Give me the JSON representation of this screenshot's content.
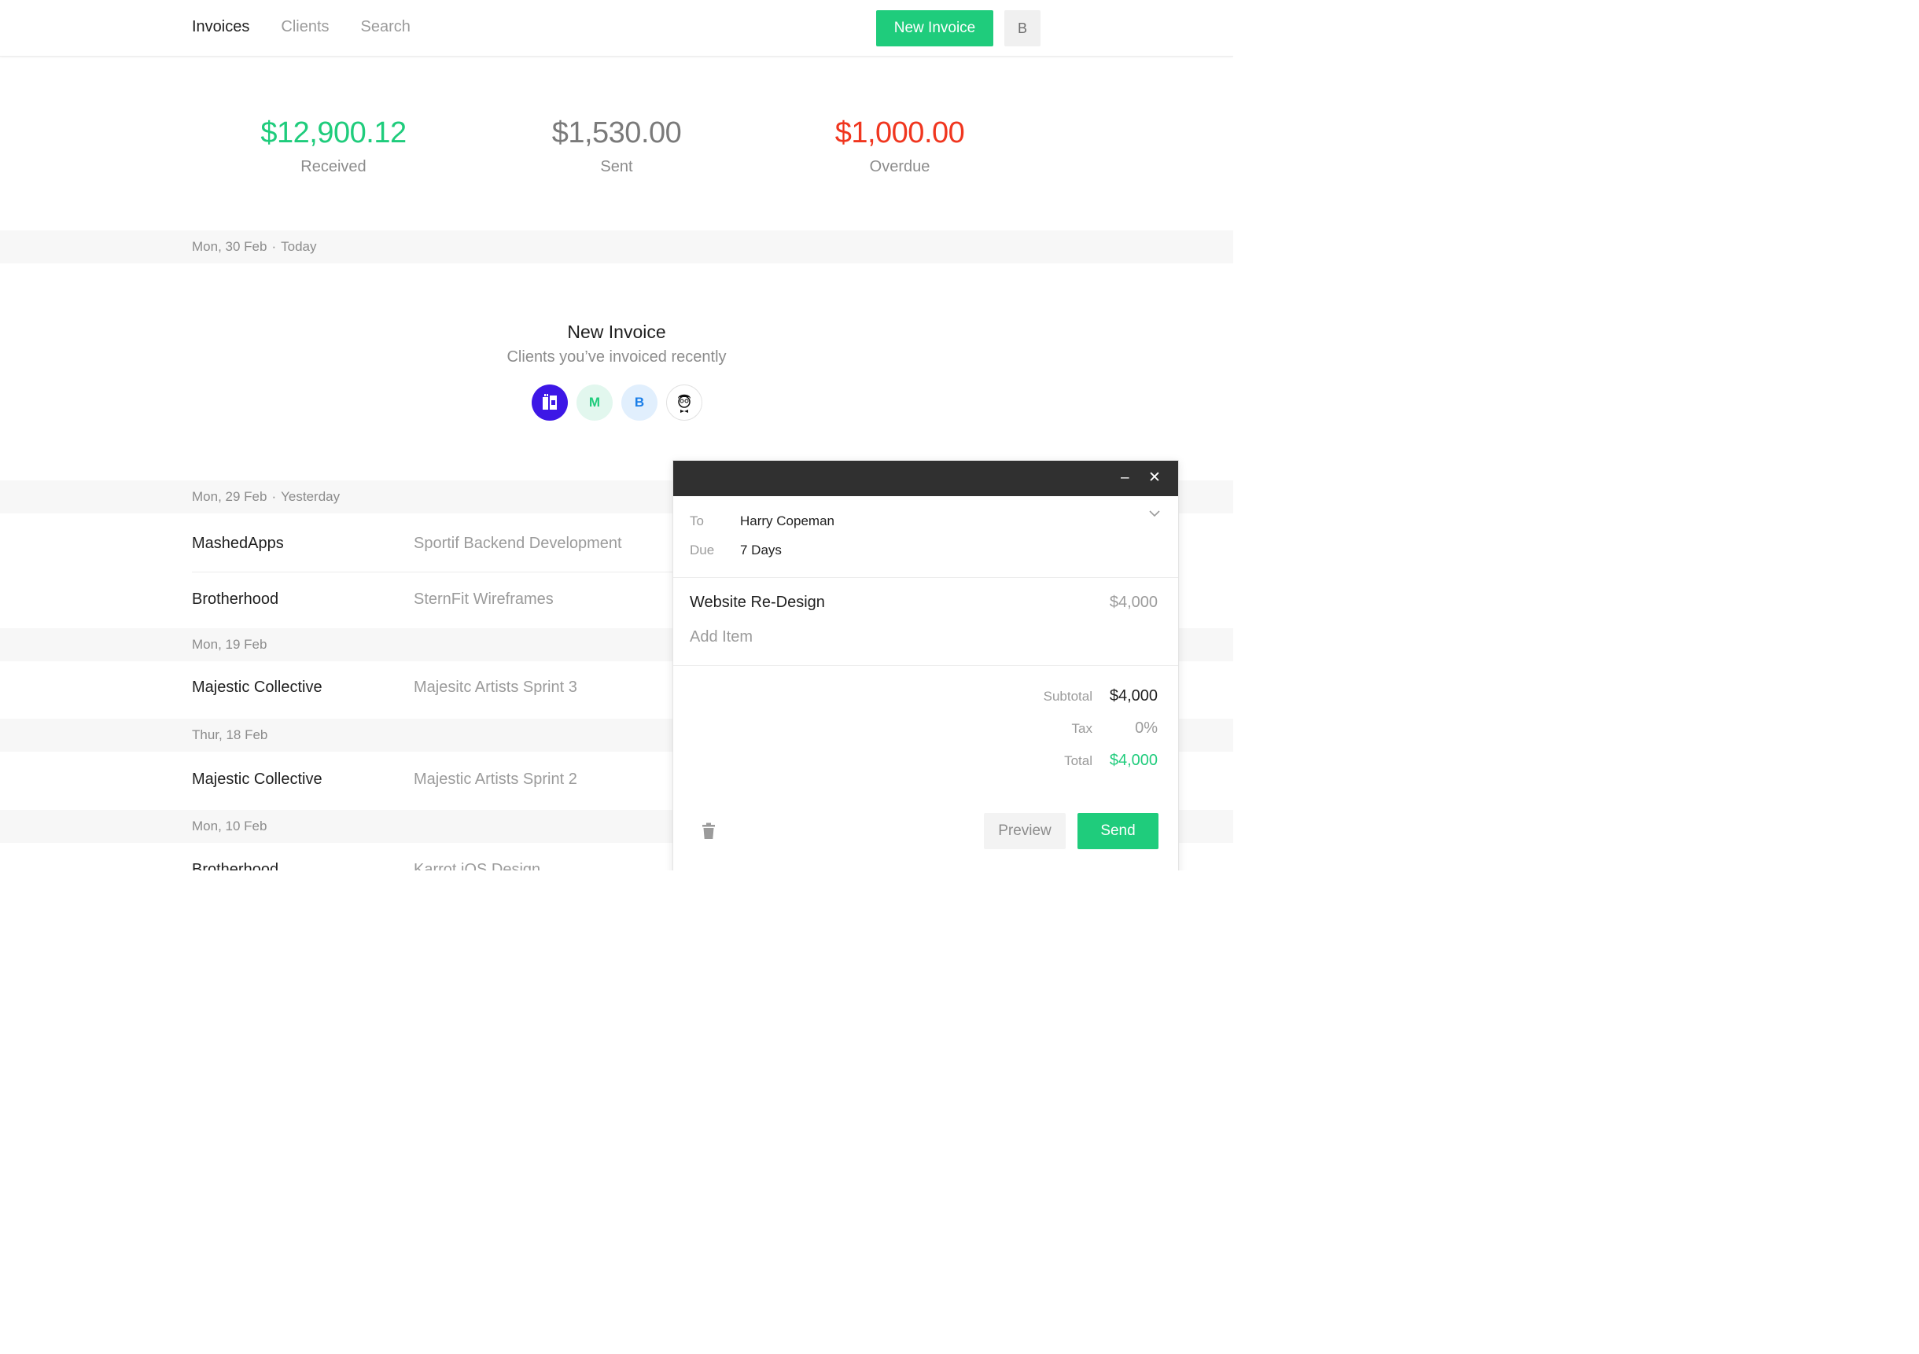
{
  "nav": {
    "items": [
      {
        "label": "Invoices",
        "active": true
      },
      {
        "label": "Clients",
        "active": false
      },
      {
        "label": "Search",
        "active": false
      }
    ],
    "new_invoice_label": "New Invoice",
    "user_initial": "B"
  },
  "stats": {
    "received": {
      "amount": "$12,900.12",
      "label": "Received",
      "color": "#1fcc7c"
    },
    "sent": {
      "amount": "$1,530.00",
      "label": "Sent",
      "color": "#7a7a7a"
    },
    "overdue": {
      "amount": "$1,000.00",
      "label": "Overdue",
      "color": "#f0361f"
    }
  },
  "today": {
    "date": "Mon, 30 Feb",
    "relative": "Today"
  },
  "new_invoice": {
    "title": "New Invoice",
    "subtitle": "Clients you’ve invoiced recently",
    "recent_clients": [
      {
        "type": "logo",
        "icon": "brand-logo-icon"
      },
      {
        "type": "initial",
        "initial": "M"
      },
      {
        "type": "initial",
        "initial": "B"
      },
      {
        "type": "logo",
        "icon": "person-illustration-icon"
      }
    ]
  },
  "groups": [
    {
      "date": "Mon, 29 Feb",
      "relative": "Yesterday",
      "invoices": [
        {
          "client": "MashedApps",
          "project": "Sportif Backend Development"
        },
        {
          "client": "Brotherhood",
          "project": "SternFit Wireframes"
        }
      ]
    },
    {
      "date": "Mon, 19 Feb",
      "invoices": [
        {
          "client": "Majestic Collective",
          "project": "Majesitc Artists Sprint 3"
        }
      ]
    },
    {
      "date": "Thur, 18 Feb",
      "invoices": [
        {
          "client": "Majestic Collective",
          "project": "Majestic Artists Sprint 2"
        }
      ]
    },
    {
      "date": "Mon, 10 Feb",
      "invoices": [
        {
          "client": "Brotherhood",
          "project": "Karrot iOS Design"
        }
      ]
    }
  ],
  "compose": {
    "minimize_icon": "minimize-icon",
    "close_icon": "close-icon",
    "to_label": "To",
    "to_value": "Harry Copeman",
    "due_label": "Due",
    "due_value": "7 Days",
    "item": {
      "name": "Website Re-Design",
      "price": "$4,000"
    },
    "add_item": "Add Item",
    "subtotal_label": "Subtotal",
    "subtotal_value": "$4,000",
    "tax_label": "Tax",
    "tax_value": "0%",
    "total_label": "Total",
    "total_value": "$4,000",
    "preview_label": "Preview",
    "send_label": "Send",
    "accent": "#1fcc7c"
  }
}
